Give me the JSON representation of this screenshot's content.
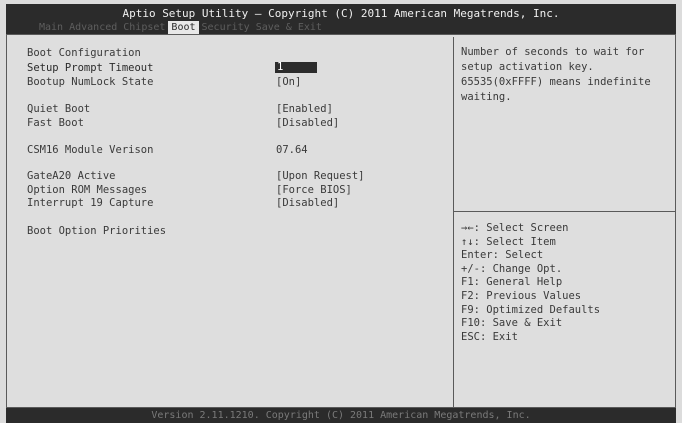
{
  "header": {
    "title": "Aptio Setup Utility – Copyright (C) 2011 American Megatrends, Inc.",
    "tabs": [
      "Main",
      "Advanced",
      "Chipset",
      "Boot",
      "Security",
      "Save & Exit"
    ],
    "active_tab": "Boot"
  },
  "main": {
    "section_title": "Boot Configuration",
    "setup_prompt_timeout": {
      "label": "Setup Prompt Timeout",
      "value": "1"
    },
    "bootup_numlock": {
      "label": "Bootup NumLock State",
      "value": "[On]"
    },
    "quiet_boot": {
      "label": "Quiet Boot",
      "value": "[Enabled]"
    },
    "fast_boot": {
      "label": "Fast Boot",
      "value": "[Disabled]"
    },
    "csm16": {
      "label": "CSM16 Module Verison",
      "value": "07.64"
    },
    "gatea20": {
      "label": "GateA20 Active",
      "value": "[Upon Request]"
    },
    "option_rom": {
      "label": "Option ROM Messages",
      "value": "[Force BIOS]"
    },
    "int19": {
      "label": "Interrupt 19 Capture",
      "value": "[Disabled]"
    },
    "boot_priorities": {
      "label": "Boot Option Priorities"
    }
  },
  "help": {
    "text": "Number of seconds to wait for\nsetup activation key.\n65535(0xFFFF) means indefinite\nwaiting."
  },
  "keys": [
    "→←: Select Screen",
    "↑↓: Select Item",
    "Enter: Select",
    "+/-: Change Opt.",
    "F1: General Help",
    "F2: Previous Values",
    "F9: Optimized Defaults",
    "F10: Save & Exit",
    "ESC: Exit"
  ],
  "footer": {
    "text": "Version 2.11.1210. Copyright (C) 2011 American Megatrends, Inc."
  }
}
